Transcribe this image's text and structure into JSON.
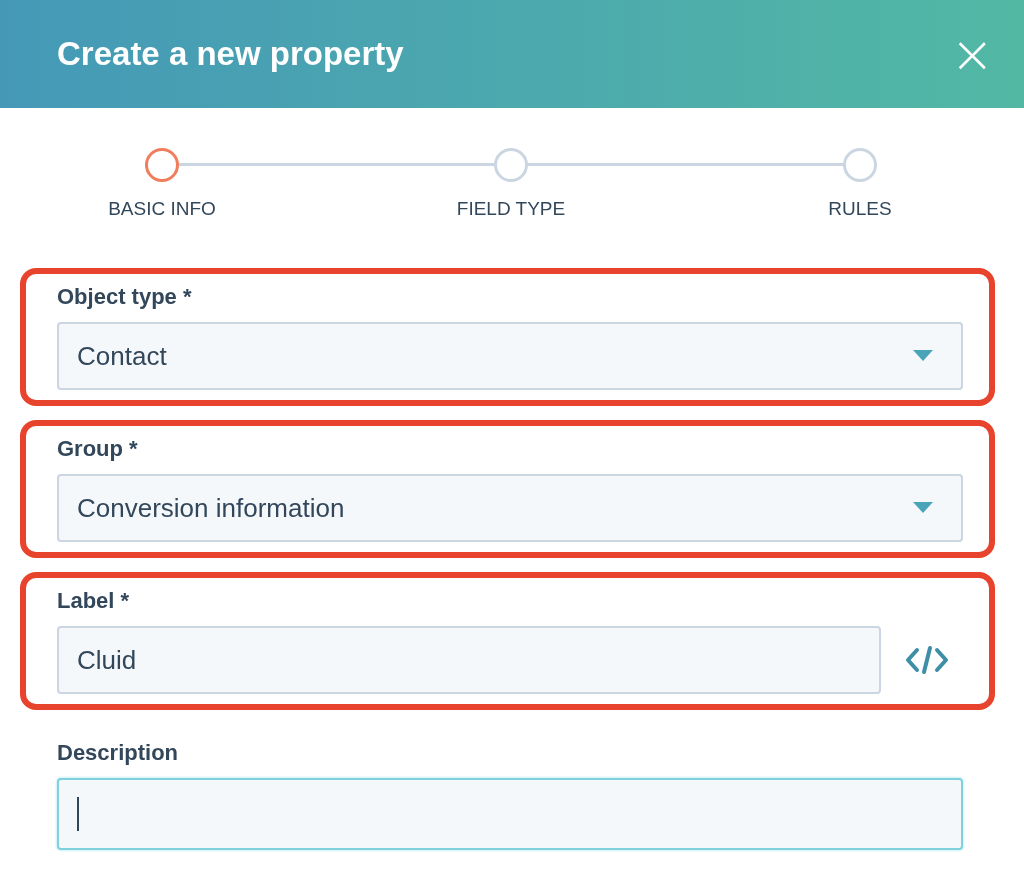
{
  "dialog": {
    "title": "Create a new property",
    "close": "×"
  },
  "steps": [
    {
      "label": "BASIC INFO",
      "selected": true
    },
    {
      "label": "FIELD TYPE",
      "selected": false
    },
    {
      "label": "RULES",
      "selected": false
    }
  ],
  "fields": [
    {
      "kind": "select",
      "label": "Object type *",
      "value": "Contact",
      "highlighted": true
    },
    {
      "kind": "select",
      "label": "Group *",
      "value": "Conversion information",
      "highlighted": true
    },
    {
      "kind": "code",
      "label": "Label *",
      "value": "Cluid",
      "highlighted": true
    },
    {
      "kind": "text",
      "label": "Description",
      "highlighted": false,
      "focused": true
    }
  ]
}
